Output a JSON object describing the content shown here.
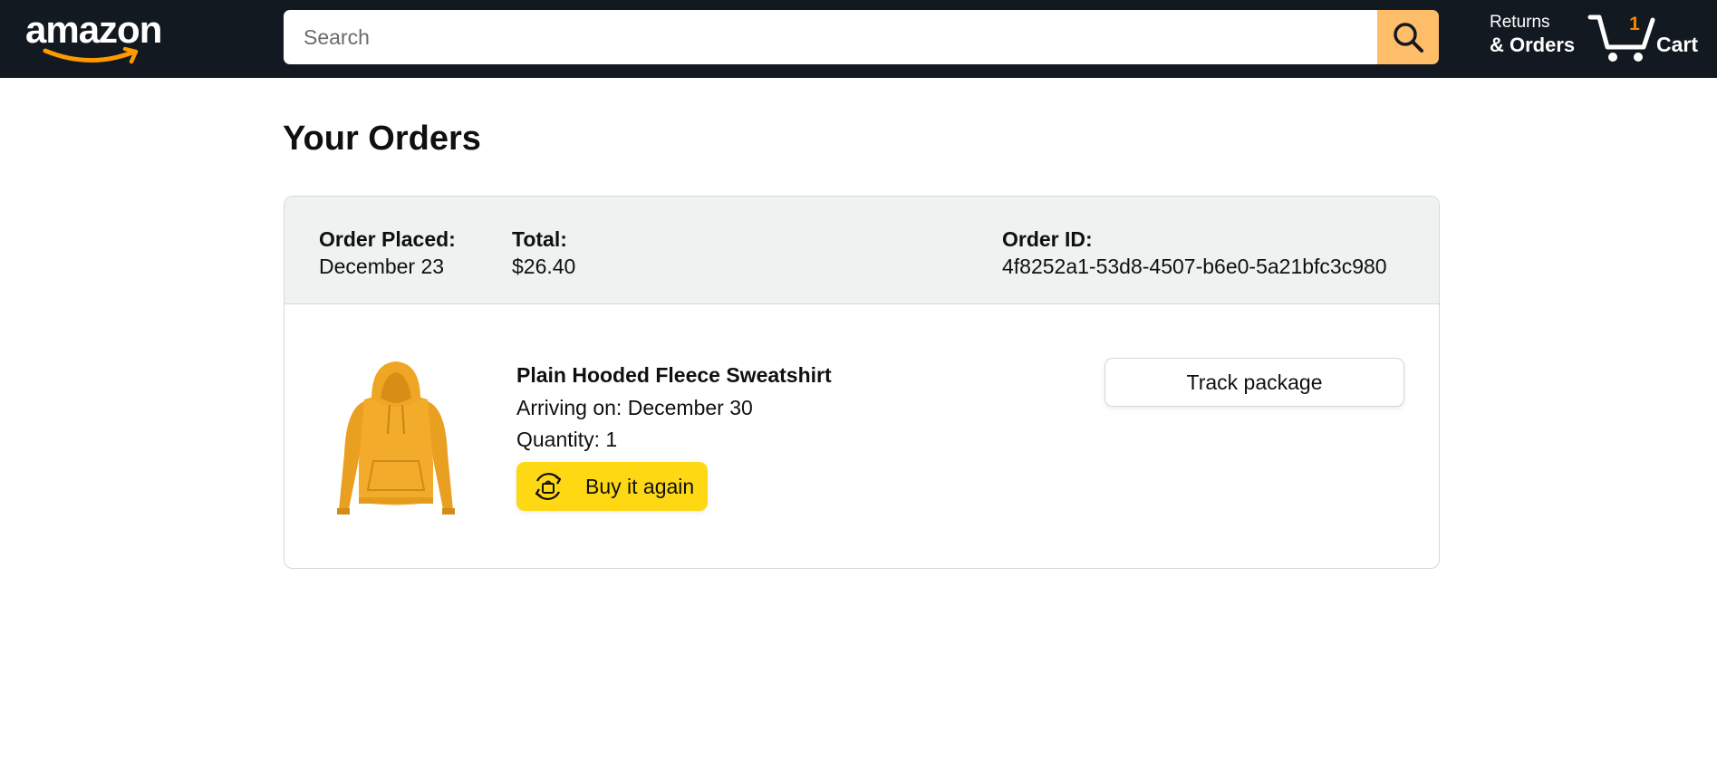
{
  "header": {
    "logo_text": "amazon",
    "search": {
      "placeholder": "Search",
      "value": ""
    },
    "returns_top": "Returns",
    "returns_bottom": "& Orders",
    "cart_count": "1",
    "cart_label": "Cart"
  },
  "page": {
    "title": "Your Orders"
  },
  "order": {
    "placed_label": "Order Placed:",
    "placed_value": "December 23",
    "total_label": "Total:",
    "total_value": "$26.40",
    "id_label": "Order ID:",
    "id_value": "4f8252a1-53d8-4507-b6e0-5a21bfc3c980",
    "item": {
      "name": "Plain Hooded Fleece Sweatshirt",
      "arriving": "Arriving on: December 30",
      "quantity": "Quantity: 1",
      "buy_again_label": "Buy it again",
      "track_label": "Track package"
    }
  },
  "colors": {
    "header_bg": "#131921",
    "search_button": "#febd69",
    "cart_count": "#f08804",
    "buy_again": "#ffd814",
    "order_header_bg": "#f0f2f2",
    "product": "#f0a92a"
  },
  "icons": {
    "search": "search-icon",
    "cart": "cart-icon",
    "buy_again": "buy-again-icon",
    "logo_smile": "amazon-smile-icon"
  }
}
